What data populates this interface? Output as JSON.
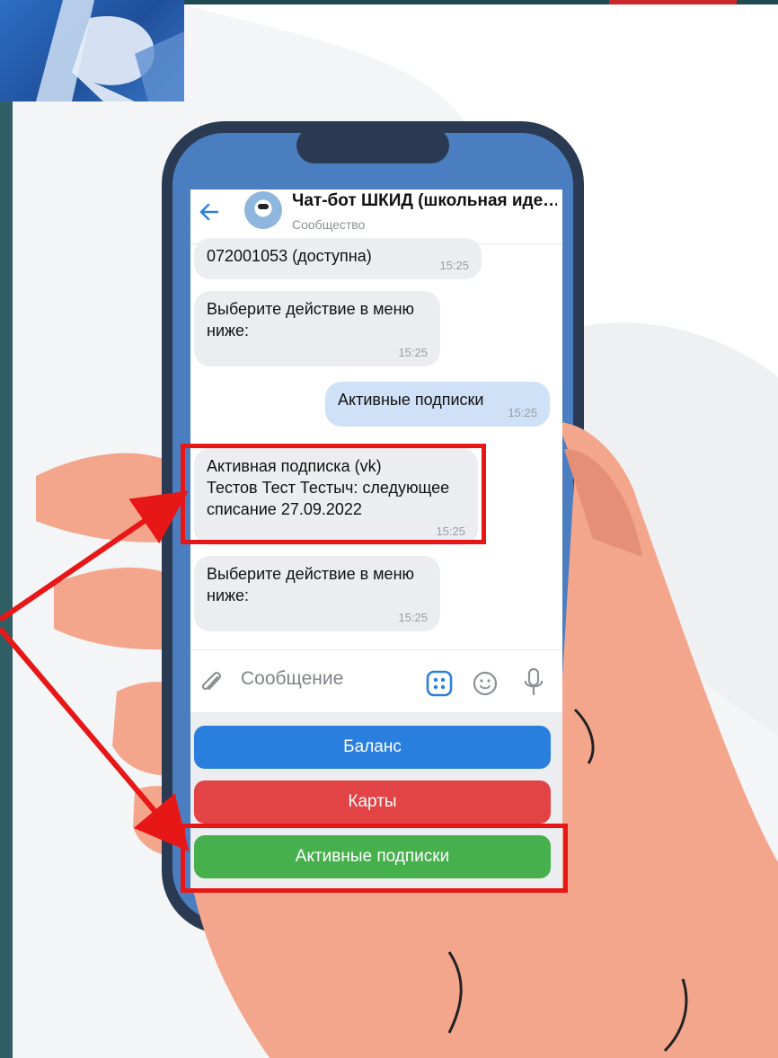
{
  "colors": {
    "teal_bg": "#2f5e64",
    "hand": "#f4a68c",
    "phone_body": "#2a3a52",
    "phone_screen_frame": "#4b7ec0",
    "highlight": "#e81717",
    "kb_blue": "#2a7fde",
    "kb_red": "#e24446",
    "kb_green": "#46b04d"
  },
  "header": {
    "title": "Чат-бот ШКИД (школьная иде…",
    "subtitle": "Сообщество",
    "back_icon": "arrow-left-icon",
    "avatar_icon": "robot-avatar-icon"
  },
  "messages": [
    {
      "text": "072001053 (доступна)",
      "time": "15:25",
      "direction": "in"
    },
    {
      "text": "Выберите действие в меню\nниже:",
      "time": "15:25",
      "direction": "in"
    },
    {
      "text": "Активные подписки",
      "time": "15:25",
      "direction": "out"
    },
    {
      "text": "Активная подписка (vk)\nТестов Тест Тестыч: следующее\nсписание 27.09.2022",
      "time": "15:25",
      "direction": "in"
    },
    {
      "text": "Выберите действие в меню\nниже:",
      "time": "15:25",
      "direction": "in"
    }
  ],
  "composer": {
    "placeholder": "Сообщение",
    "attach_icon": "paperclip-icon",
    "keyboard_icon": "bot-keyboard-icon",
    "emoji_icon": "smile-icon",
    "mic_icon": "microphone-icon"
  },
  "keyboard": {
    "buttons": [
      {
        "label": "Баланс",
        "color": "#2a7fde"
      },
      {
        "label": "Карты",
        "color": "#e24446"
      },
      {
        "label": "Активные подписки",
        "color": "#46b04d"
      }
    ]
  }
}
